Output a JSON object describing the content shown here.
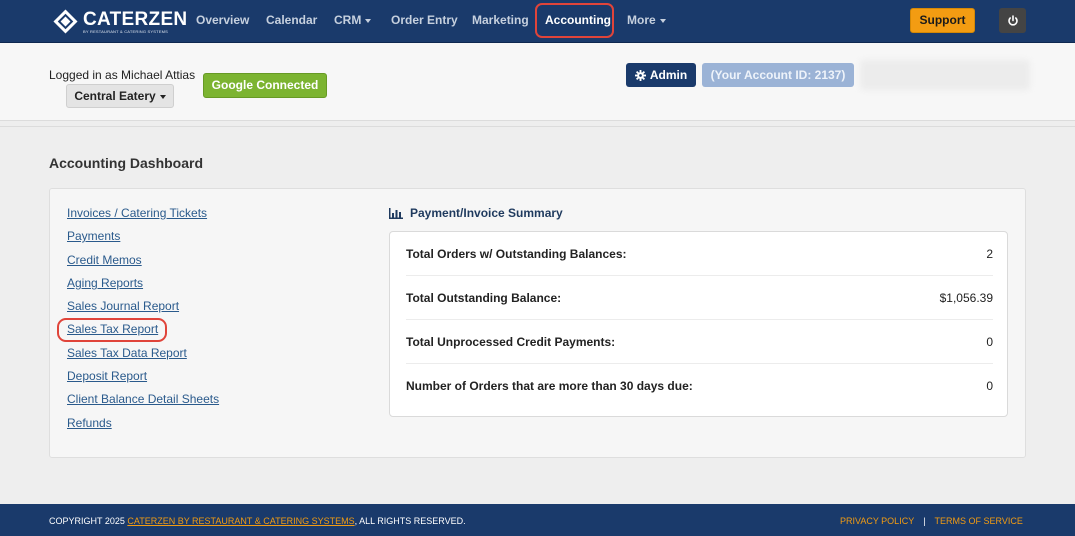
{
  "brand": {
    "name": "CATERZEN",
    "tagline": "BY RESTAURANT & CATERING SYSTEMS"
  },
  "nav": {
    "items": [
      {
        "label": "Overview"
      },
      {
        "label": "Calendar"
      },
      {
        "label": "CRM"
      },
      {
        "label": "Order Entry"
      },
      {
        "label": "Marketing"
      },
      {
        "label": "Accounting"
      },
      {
        "label": "More"
      }
    ],
    "support_label": "Support"
  },
  "header": {
    "logged_in": "Logged in as Michael Attias",
    "location": "Central Eatery",
    "google_label": "Google Connected",
    "admin_label": "Admin",
    "account_id": "(Your Account ID: 2137)"
  },
  "page": {
    "title": "Accounting Dashboard"
  },
  "links": [
    "Invoices / Catering Tickets",
    "Payments",
    "Credit Memos",
    "Aging Reports",
    "Sales Journal Report",
    "Sales Tax Report",
    "Sales Tax Data Report",
    "Deposit Report",
    "Client Balance Detail Sheets",
    "Refunds"
  ],
  "summary": {
    "title": "Payment/Invoice Summary",
    "rows": [
      {
        "label": "Total Orders w/ Outstanding Balances:",
        "value": "2"
      },
      {
        "label": "Total Outstanding Balance:",
        "value": "$1,056.39"
      },
      {
        "label": "Total Unprocessed Credit Payments:",
        "value": "0"
      },
      {
        "label": "Number of Orders that are more than 30 days due:",
        "value": "0"
      }
    ]
  },
  "footer": {
    "copyright_prefix": "COPYRIGHT 2025 ",
    "copyright_link": "CATERZEN BY RESTAURANT & CATERING SYSTEMS",
    "copyright_suffix": ", ALL RIGHTS RESERVED.",
    "privacy": "PRIVACY POLICY",
    "separator": "|",
    "terms": "TERMS OF SERVICE"
  },
  "colors": {
    "nav_bg": "#1a3a6b",
    "support": "#f39c12",
    "google": "#7cb431",
    "highlight": "#e0443a",
    "link": "#2a5a8c"
  }
}
